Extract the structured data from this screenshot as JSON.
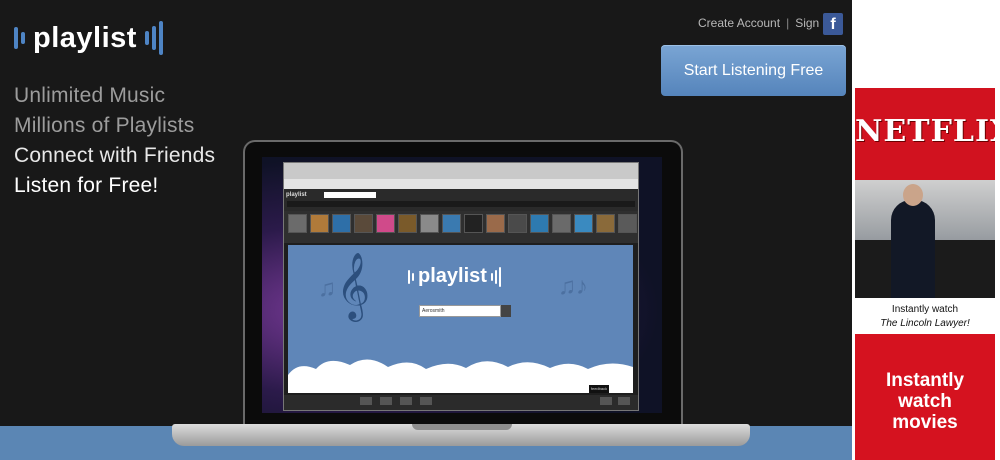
{
  "brand": {
    "name": "playlist",
    "accent": "#4e84c4"
  },
  "header": {
    "create_account": "Create Account",
    "separator": "|",
    "sign_in": "Sign In",
    "facebook_glyph": "f",
    "cta": "Start Listening Free"
  },
  "taglines": [
    "Unlimited Music",
    "Millions of Playlists",
    "Connect with Friends",
    "Listen for Free!"
  ],
  "laptop_screen": {
    "app_name": "playlist",
    "search_value": "Aerosmith",
    "feedback": "feedback"
  },
  "ad": {
    "brand": "NETFLIX",
    "line1": "Instantly watch",
    "line2": "The Lincoln Lawyer!",
    "cta_line1": "Instantly",
    "cta_line2": "watch",
    "cta_line3": "movies",
    "color": "#d5121f"
  },
  "colors": {
    "background": "#181818",
    "cta": "#5f8dc4",
    "bottom_bar": "#5b86b4"
  }
}
